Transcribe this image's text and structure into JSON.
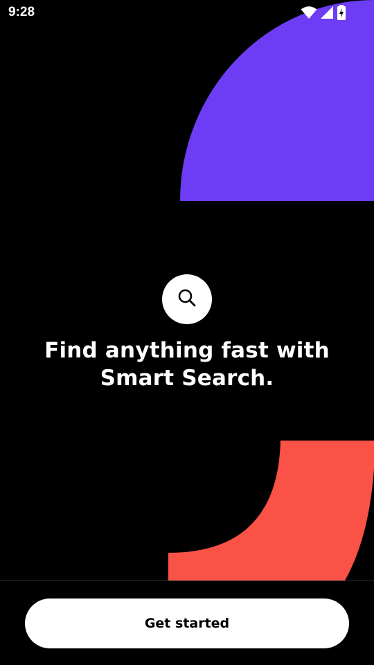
{
  "status_bar": {
    "time": "9:28",
    "icons": [
      "wifi-icon",
      "cellular-signal-icon",
      "battery-charging-icon"
    ]
  },
  "onboarding": {
    "icon": "search-icon",
    "title": "Find anything fast with Smart Search.",
    "cta_label": "Get started"
  },
  "colors": {
    "background": "#000000",
    "accent_purple": "#6C3DF4",
    "accent_red": "#FA5246",
    "button_background": "#FFFFFF",
    "button_text": "#000000"
  }
}
